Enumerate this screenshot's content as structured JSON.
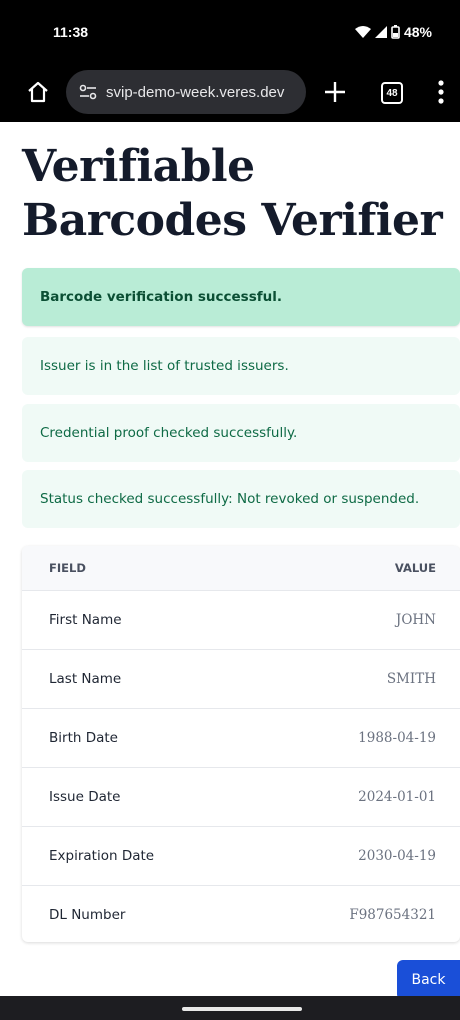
{
  "status_bar": {
    "time": "11:38",
    "battery": "48%"
  },
  "browser": {
    "url": "svip-demo-week.veres.dev",
    "tab_count": "48",
    "icons": [
      "home-icon",
      "site-settings-icon",
      "plus-icon",
      "tabs-icon",
      "more-vert-icon"
    ]
  },
  "page": {
    "title_line1": "Verifiable",
    "title_line2": "Barcodes Verifier"
  },
  "alerts": [
    "Barcode verification successful.",
    "Issuer is in the list of trusted issuers.",
    "Credential proof checked successfully.",
    "Status checked successfully: Not revoked or suspended."
  ],
  "table": {
    "headers": [
      "FIELD",
      "VALUE"
    ],
    "rows": [
      {
        "field": "First Name",
        "value": "JOHN"
      },
      {
        "field": "Last Name",
        "value": "SMITH"
      },
      {
        "field": "Birth Date",
        "value": "1988-04-19"
      },
      {
        "field": "Issue Date",
        "value": "2024-01-01"
      },
      {
        "field": "Expiration Date",
        "value": "2030-04-19"
      },
      {
        "field": "DL Number",
        "value": "F987654321"
      }
    ]
  },
  "actions": {
    "back_label": "Back"
  },
  "colors": {
    "success_bg": "#b9ecd6",
    "info_bg": "#f0faf6",
    "info_text": "#0e6a45",
    "button_blue": "#1a4fd8",
    "title_text": "#141b2b"
  }
}
